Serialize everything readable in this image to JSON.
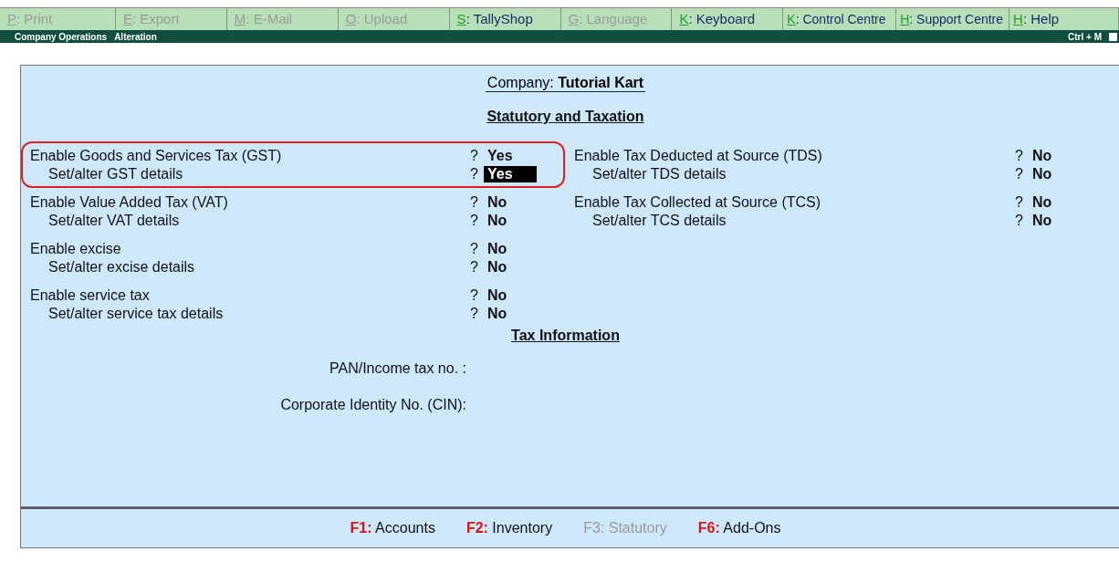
{
  "toolbar": [
    {
      "key": "P",
      "label": "Print",
      "disabled": true
    },
    {
      "key": "E",
      "label": "Export",
      "disabled": true
    },
    {
      "key": "M",
      "label": "E-Mail",
      "disabled": true
    },
    {
      "key": "O",
      "label": "Upload",
      "disabled": true
    },
    {
      "key": "S",
      "label": "TallyShop",
      "disabled": false
    },
    {
      "key": "G",
      "label": "Language",
      "disabled": true
    },
    {
      "key": "K",
      "label": "Keyboard",
      "disabled": false
    },
    {
      "key": "K",
      "label": "Control Centre",
      "disabled": false
    },
    {
      "key": "H",
      "label": "Support Centre",
      "disabled": false
    },
    {
      "key": "H",
      "label": "Help",
      "disabled": false
    }
  ],
  "prompt": "?",
  "key_sep": ":",
  "title_bar": {
    "left": [
      "Company Operations",
      "Alteration"
    ],
    "shortcut": "Ctrl + M"
  },
  "company": {
    "label": "Company:",
    "name": "Tutorial Kart"
  },
  "section_title": "Statutory and Taxation",
  "left_groups": [
    {
      "highlighted": true,
      "rows": [
        {
          "label": "Enable Goods and Services Tax (GST)",
          "value": "Yes",
          "sub": false,
          "focused": false
        },
        {
          "label": "Set/alter GST details",
          "value": "Yes",
          "sub": true,
          "focused": true
        }
      ]
    },
    {
      "highlighted": false,
      "rows": [
        {
          "label": "Enable Value Added Tax (VAT)",
          "value": "No",
          "sub": false,
          "focused": false
        },
        {
          "label": "Set/alter VAT details",
          "value": "No",
          "sub": true,
          "focused": false
        }
      ]
    },
    {
      "highlighted": false,
      "rows": [
        {
          "label": "Enable excise",
          "value": "No",
          "sub": false,
          "focused": false
        },
        {
          "label": "Set/alter excise details",
          "value": "No",
          "sub": true,
          "focused": false
        }
      ]
    },
    {
      "highlighted": false,
      "rows": [
        {
          "label": "Enable service tax",
          "value": "No",
          "sub": false,
          "focused": false
        },
        {
          "label": "Set/alter service tax details",
          "value": "No",
          "sub": true,
          "focused": false
        }
      ]
    }
  ],
  "right_groups": [
    {
      "highlighted": false,
      "rows": [
        {
          "label": "Enable Tax Deducted at Source (TDS)",
          "value": "No",
          "sub": false,
          "focused": false
        },
        {
          "label": "Set/alter TDS details",
          "value": "No",
          "sub": true,
          "focused": false
        }
      ]
    },
    {
      "highlighted": false,
      "rows": [
        {
          "label": "Enable Tax Collected at Source (TCS)",
          "value": "No",
          "sub": false,
          "focused": false
        },
        {
          "label": "Set/alter TCS details",
          "value": "No",
          "sub": true,
          "focused": false
        }
      ]
    }
  ],
  "tax_info": {
    "title": "Tax Information",
    "fields": [
      {
        "label": "PAN/Income tax no. :"
      },
      {
        "label": "Corporate Identity No. (CIN):"
      }
    ]
  },
  "footer": [
    {
      "key": "F1:",
      "label": "Accounts",
      "disabled": false
    },
    {
      "key": "F2:",
      "label": "Inventory",
      "disabled": false
    },
    {
      "key": "F3:",
      "label": "Statutory",
      "disabled": true
    },
    {
      "key": "F6:",
      "label": "Add-Ons",
      "disabled": false
    }
  ]
}
